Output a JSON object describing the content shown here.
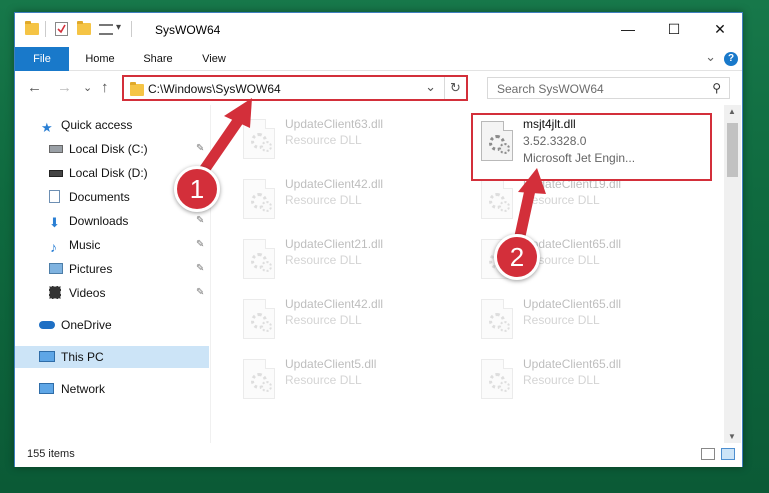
{
  "window": {
    "title": "SysWOW64",
    "min_icon": "—",
    "max_icon": "☐",
    "close_icon": "✕"
  },
  "ribbon": {
    "tabs": [
      "File",
      "Home",
      "Share",
      "View"
    ],
    "expand_icon": "⌄",
    "help_icon": "?"
  },
  "addressbar": {
    "path": "C:\\Windows\\SysWOW64",
    "back_icon": "←",
    "forward_icon": "→",
    "recent_icon": "⌄",
    "up_icon": "↑",
    "dropdown_icon": "⌄",
    "refresh_icon": "↻"
  },
  "search": {
    "placeholder": "Search SysWOW64",
    "icon": "⚲"
  },
  "sidebar": {
    "items": [
      {
        "label": "Quick access",
        "icon": "star-icon",
        "pinned": false
      },
      {
        "label": "Local Disk (C:)",
        "icon": "drive-icon",
        "pinned": true
      },
      {
        "label": "Local Disk (D:)",
        "icon": "drive-icon",
        "pinned": false
      },
      {
        "label": "Documents",
        "icon": "documents-icon",
        "pinned": true
      },
      {
        "label": "Downloads",
        "icon": "download-icon",
        "pinned": true
      },
      {
        "label": "Music",
        "icon": "music-icon",
        "pinned": true
      },
      {
        "label": "Pictures",
        "icon": "pictures-icon",
        "pinned": true
      },
      {
        "label": "Videos",
        "icon": "videos-icon",
        "pinned": true
      },
      {
        "label": "OneDrive",
        "icon": "cloud-icon",
        "pinned": false
      },
      {
        "label": "This PC",
        "icon": "computer-icon",
        "pinned": false,
        "selected": true
      },
      {
        "label": "Network",
        "icon": "network-icon",
        "pinned": false
      }
    ],
    "pin_icon": "📌"
  },
  "files": {
    "left": [
      {
        "name": "UpdateClient63.dll",
        "type": "Resource DLL"
      },
      {
        "name": "UpdateClient42.dll",
        "type": "Resource DLL"
      },
      {
        "name": "UpdateClient21.dll",
        "type": "Resource DLL"
      },
      {
        "name": "UpdateClient42.dll",
        "type": "Resource DLL"
      },
      {
        "name": "UpdateClient5.dll",
        "type": "Resource DLL"
      }
    ],
    "right": [
      {
        "name": "msjt4jlt.dll",
        "type": "3.52.3328.0",
        "desc": "Microsoft Jet Engin..."
      },
      {
        "name": "UpdateClient19.dll",
        "type": "Resource DLL"
      },
      {
        "name": "UpdateClient65.dll",
        "type": "Resource DLL"
      },
      {
        "name": "UpdateClient65.dll",
        "type": "Resource DLL"
      },
      {
        "name": "UpdateClient65.dll",
        "type": "Resource DLL"
      }
    ]
  },
  "status": {
    "item_count": "155 items"
  },
  "callouts": [
    "1",
    "2"
  ],
  "colors": {
    "accent": "#1979ca",
    "callout_red": "#d32f3a",
    "selection": "#cce4f7"
  }
}
